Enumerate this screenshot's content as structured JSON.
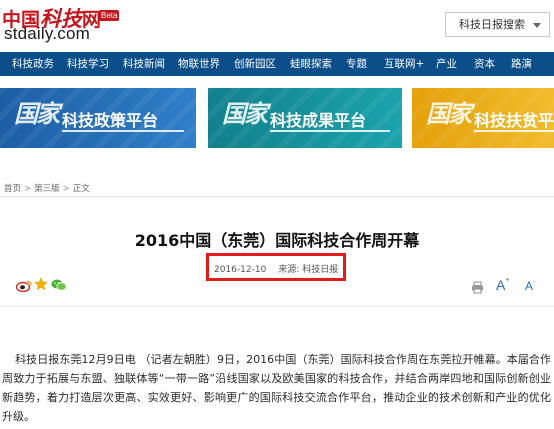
{
  "header": {
    "logo_cn_1": "中国",
    "logo_cn_2": "科技",
    "logo_cn_3": "网",
    "logo_beta": "Beta",
    "logo_en": "stdaily.com",
    "search_selected": "科技日报搜索"
  },
  "nav": {
    "items": [
      "科技政务",
      "科技学习",
      "科技新闻",
      "物联世界",
      "创新园区",
      "蛙眼探索",
      "专题",
      "互联网+",
      "产业",
      "资本",
      "路演"
    ],
    "bg_color": "#0b4e8a"
  },
  "banners": [
    {
      "mark": "国家",
      "text": "科技政策平台",
      "color": "#1c5ea6"
    },
    {
      "mark": "国家",
      "text": "科技成果平台",
      "color": "#11808d"
    },
    {
      "mark": "国家",
      "text": "科技扶贫平",
      "color": "#e4a10a"
    }
  ],
  "breadcrumb": {
    "items": [
      "首页",
      "第三版",
      "正文"
    ],
    "separator": ">"
  },
  "article": {
    "title": "2016中国（东莞）国际科技合作周开幕",
    "date": "2016-12-10",
    "source": "来源: 科技日报",
    "highlight_color": "#e21b1b",
    "body": "科技日报东莞12月9日电 （记者左朝胜）9日，2016中国（东莞）国际科技合作周在东莞拉开帷幕。本届合作周致力于拓展与东盟、独联体等“一带一路”沿线国家以及欧美国家的科技合作，并结合两岸四地和国际创新创业新趋势，着力打造层次更高、实效更好、影响更广的国际科技交流合作平台，推动企业的技术创新和产业的优化升级。"
  },
  "toolbar": {
    "share_icons": [
      "weibo-icon",
      "star-icon",
      "wechat-icon"
    ],
    "font_large": "A",
    "font_large_sup": "+",
    "font_small": "A",
    "font_small_sup": "-"
  }
}
